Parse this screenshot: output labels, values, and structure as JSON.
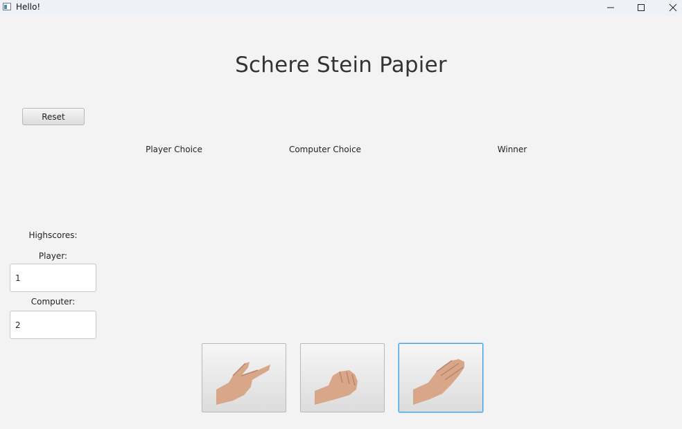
{
  "window": {
    "title": "Hello!"
  },
  "heading": "Schere Stein Papier",
  "reset_label": "Reset",
  "columns": {
    "player": "Player Choice",
    "computer": "Computer Choice",
    "winner": "Winner"
  },
  "highscores": {
    "title": "Highscores:",
    "player_label": "Player:",
    "player_value": "1",
    "computer_label": "Computer:",
    "computer_value": "2"
  },
  "choices": [
    {
      "name": "scissors",
      "icon": "scissors-hand-icon"
    },
    {
      "name": "rock",
      "icon": "rock-fist-icon"
    },
    {
      "name": "paper",
      "icon": "paper-hand-icon",
      "focused": true
    }
  ],
  "colors": {
    "focus": "#3aa3e3",
    "skin": "#d8a688"
  }
}
